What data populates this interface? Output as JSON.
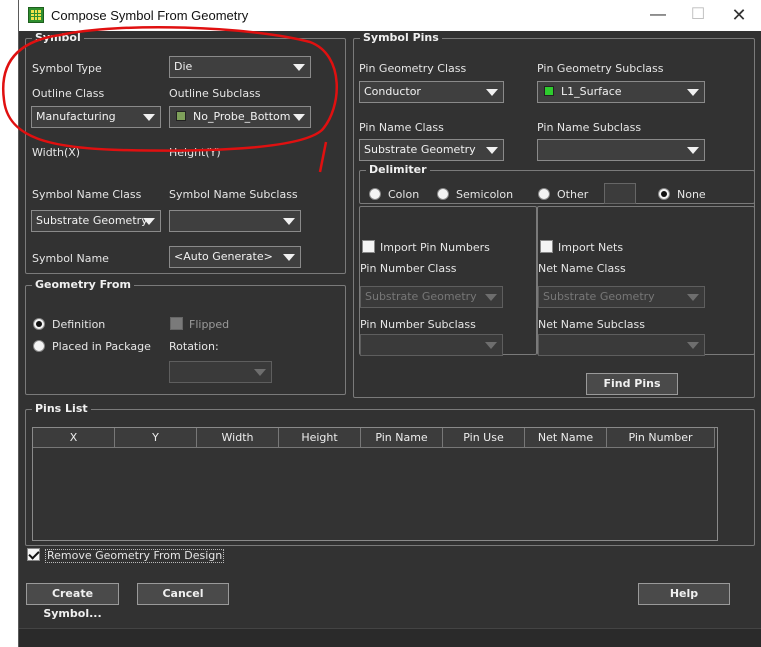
{
  "window": {
    "title": "Compose Symbol From Geometry"
  },
  "symbol": {
    "title": "Symbol",
    "symbol_type_label": "Symbol Type",
    "symbol_type_value": "Die",
    "outline_class_label": "Outline Class",
    "outline_class_value": "Manufacturing",
    "outline_subclass_label": "Outline Subclass",
    "outline_subclass_value": "No_Probe_Bottom",
    "width_label": "Width(X)",
    "height_label": "Height(Y)",
    "name_class_label": "Symbol Name Class",
    "name_class_value": "Substrate Geometry",
    "name_subclass_label": "Symbol Name Subclass",
    "name_subclass_value": "",
    "symbol_name_label": "Symbol Name",
    "symbol_name_value": "<Auto Generate>"
  },
  "geometry_from": {
    "title": "Geometry From",
    "definition_label": "Definition",
    "placed_label": "Placed in Package",
    "flipped_label": "Flipped",
    "rotation_label": "Rotation:"
  },
  "symbol_pins": {
    "title": "Symbol Pins",
    "pin_geom_class_label": "Pin Geometry Class",
    "pin_geom_class_value": "Conductor",
    "pin_geom_subclass_label": "Pin Geometry Subclass",
    "pin_geom_subclass_value": "L1_Surface",
    "pin_name_class_label": "Pin Name Class",
    "pin_name_class_value": "Substrate Geometry",
    "pin_name_subclass_label": "Pin Name Subclass",
    "delimiter_title": "Delimiter",
    "colon": "Colon",
    "semicolon": "Semicolon",
    "other": "Other",
    "none": "None",
    "import_pin_numbers": "Import Pin Numbers",
    "pin_number_class_label": "Pin Number Class",
    "pin_number_class_value": "Substrate Geometry",
    "pin_number_subclass_label": "Pin Number Subclass",
    "import_nets": "Import Nets",
    "net_name_class_label": "Net Name Class",
    "net_name_class_value": "Substrate Geometry",
    "net_name_subclass_label": "Net Name Subclass",
    "find_pins": "Find Pins"
  },
  "pins_list": {
    "title": "Pins List",
    "columns": [
      "X",
      "Y",
      "Width",
      "Height",
      "Pin Name",
      "Pin Use",
      "Net Name",
      "Pin Number"
    ]
  },
  "footer": {
    "remove_geometry": "Remove Geometry From Design",
    "create_symbol": "Create Symbol...",
    "cancel": "Cancel",
    "help": "Help"
  },
  "colors": {
    "background": "#323232",
    "annotation_red": "#e01010",
    "swatch_no_probe": "#7ea05a",
    "swatch_l1": "#2ecc2e"
  }
}
